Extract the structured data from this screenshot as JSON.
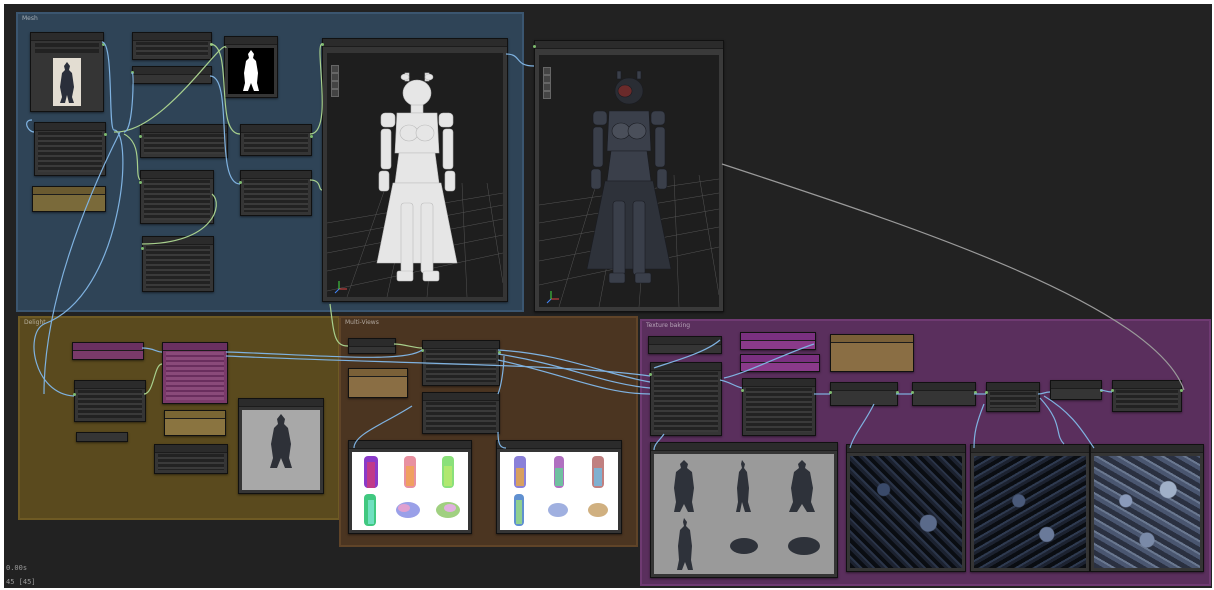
{
  "groups": {
    "mesh": "Mesh",
    "delight": "Delight",
    "multiview": "Multi-Views",
    "texture_baking": "Texture baking"
  },
  "status": {
    "time": "0.00s",
    "count": "45 [45]"
  },
  "colors": {
    "canvas": "#222222",
    "mesh_group": "#2e4358",
    "delight_group": "#5c4a1c",
    "multiview_group": "#4e3620",
    "texture_group": "#5a2e5e",
    "wire_blue": "#7fb2e0",
    "wire_green": "#a8d08d",
    "wire_gray": "#9a9a9a"
  },
  "viewport_controls": [
    "move-icon",
    "rotate-icon",
    "zoom-icon",
    "fit-icon"
  ]
}
